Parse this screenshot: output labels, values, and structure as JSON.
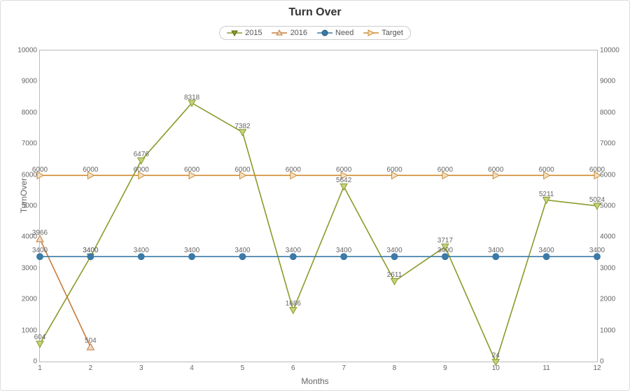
{
  "chart_data": {
    "type": "line",
    "title": "Turn Over",
    "xlabel": "Months",
    "ylabel": "TurnOver",
    "x": [
      1,
      2,
      3,
      4,
      5,
      6,
      7,
      8,
      9,
      10,
      11,
      12
    ],
    "ylim": [
      0,
      10000
    ],
    "xlim": [
      1,
      12
    ],
    "yticks": [
      0,
      1000,
      2000,
      3000,
      4000,
      5000,
      6000,
      7000,
      8000,
      9000,
      10000
    ],
    "series": [
      {
        "name": "2015",
        "color": "#8a9a2a",
        "marker": "tri-down",
        "values": [
          604,
          3400,
          6476,
          8318,
          7382,
          1686,
          5642,
          2611,
          3717,
          24,
          5211,
          5024
        ]
      },
      {
        "name": "2016",
        "color": "#c77b3a",
        "marker": "tri-up",
        "values": [
          3966,
          504,
          null,
          null,
          null,
          null,
          null,
          null,
          null,
          null,
          null,
          null
        ]
      },
      {
        "name": "Need",
        "color": "#3b7aa6",
        "marker": "circle",
        "values": [
          3400,
          3400,
          3400,
          3400,
          3400,
          3400,
          3400,
          3400,
          3400,
          3400,
          3400,
          3400
        ]
      },
      {
        "name": "Target",
        "color": "#d08a2e",
        "marker": "tri-right",
        "values": [
          6000,
          6000,
          6000,
          6000,
          6000,
          6000,
          6000,
          6000,
          6000,
          6000,
          6000,
          6000
        ]
      }
    ]
  }
}
